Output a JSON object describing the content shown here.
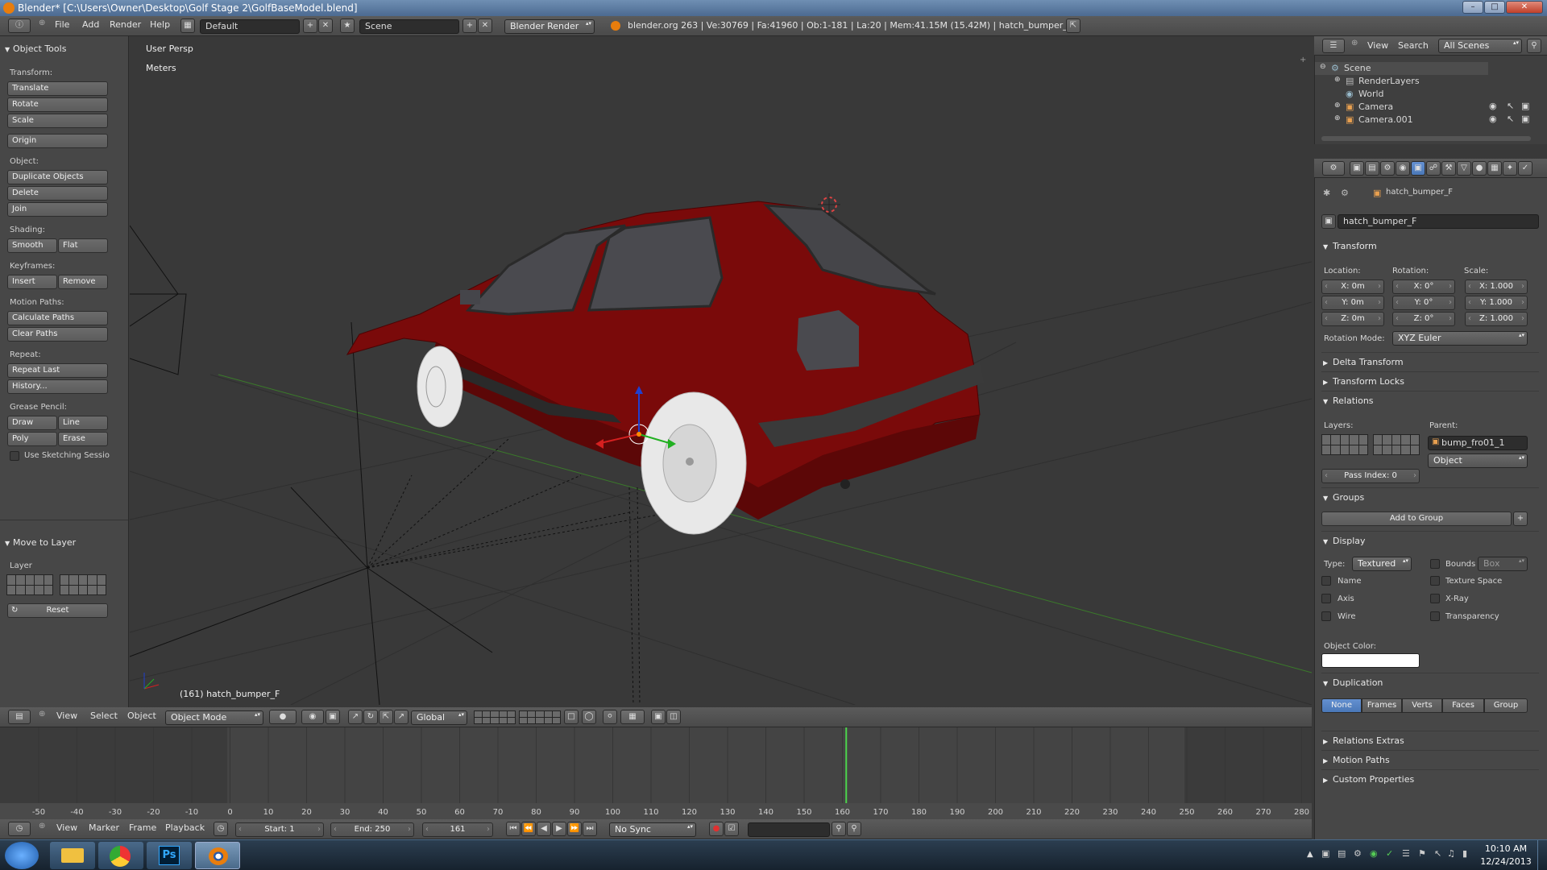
{
  "window": {
    "title": "Blender* [C:\\Users\\Owner\\Desktop\\Golf Stage 2\\GolfBaseModel.blend]",
    "controls": [
      "–",
      "□",
      "✕"
    ]
  },
  "info_header": {
    "menus": [
      "File",
      "Add",
      "Render",
      "Help"
    ],
    "screen_layout": "Default",
    "scene": "Scene",
    "render_engine": "Blender Render",
    "stats": "blender.org 263 | Ve:30769 | Fa:41960 | Ob:1-181 | La:20 | Mem:41.15M (15.42M) | hatch_bumper_F"
  },
  "tool_shelf": {
    "title": "Object Tools",
    "transform_label": "Transform:",
    "translate": "Translate",
    "rotate": "Rotate",
    "scale": "Scale",
    "origin": "Origin",
    "object_label": "Object:",
    "duplicate": "Duplicate Objects",
    "delete": "Delete",
    "join": "Join",
    "shading_label": "Shading:",
    "smooth": "Smooth",
    "flat": "Flat",
    "keyframes_label": "Keyframes:",
    "insert": "Insert",
    "remove": "Remove",
    "motion_label": "Motion Paths:",
    "calc_paths": "Calculate Paths",
    "clear_paths": "Clear Paths",
    "repeat_label": "Repeat:",
    "repeat_last": "Repeat Last",
    "history": "History...",
    "grease_label": "Grease Pencil:",
    "draw": "Draw",
    "line": "Line",
    "poly": "Poly",
    "erase": "Erase",
    "sketching": "Use Sketching Sessio",
    "move_layer_title": "Move to Layer",
    "layer_label": "Layer",
    "reset": "Reset"
  },
  "viewport": {
    "view_name": "User Persp",
    "units": "Meters",
    "object_info": "(161) hatch_bumper_F",
    "car_color": "#7a0a0a",
    "wheel_color": "#e8e8e8"
  },
  "view3d_header": {
    "menus": [
      "View",
      "Select",
      "Object"
    ],
    "mode": "Object Mode",
    "orientation": "Global"
  },
  "outliner": {
    "menus": [
      "View",
      "Search"
    ],
    "filter": "All Scenes",
    "items": [
      {
        "label": "Scene"
      },
      {
        "label": "RenderLayers"
      },
      {
        "label": "World"
      },
      {
        "label": "Camera"
      },
      {
        "label": "Camera.001"
      }
    ]
  },
  "properties": {
    "breadcrumb": "hatch_bumper_F",
    "object_name": "hatch_bumper_F",
    "transform": {
      "title": "Transform",
      "location_label": "Location:",
      "rotation_label": "Rotation:",
      "scale_label": "Scale:",
      "location": [
        "X: 0m",
        "Y: 0m",
        "Z: 0m"
      ],
      "rotation": [
        "X: 0°",
        "Y: 0°",
        "Z: 0°"
      ],
      "scale": [
        "X: 1.000",
        "Y: 1.000",
        "Z: 1.000"
      ],
      "rotation_mode_label": "Rotation Mode:",
      "rotation_mode": "XYZ Euler"
    },
    "delta_transform": "Delta Transform",
    "transform_locks": "Transform Locks",
    "relations": {
      "title": "Relations",
      "layers_label": "Layers:",
      "parent_label": "Parent:",
      "parent": "bump_fro01_1",
      "parent_type": "Object",
      "pass_index": "Pass Index: 0"
    },
    "groups": {
      "title": "Groups",
      "add_to_group": "Add to Group"
    },
    "display": {
      "title": "Display",
      "type_label": "Type:",
      "type": "Textured",
      "bounds": "Bounds",
      "bounds_type": "Box",
      "name": "Name",
      "texture_space": "Texture Space",
      "axis": "Axis",
      "xray": "X-Ray",
      "wire": "Wire",
      "transparency": "Transparency",
      "object_color_label": "Object Color:"
    },
    "duplication": {
      "title": "Duplication",
      "tabs": [
        "None",
        "Frames",
        "Verts",
        "Faces",
        "Group"
      ]
    },
    "relations_extras": "Relations Extras",
    "motion_paths": "Motion Paths",
    "custom_properties": "Custom Properties"
  },
  "timeline": {
    "ruler": [
      "-50",
      "-40",
      "-30",
      "-20",
      "-10",
      "0",
      "10",
      "20",
      "30",
      "40",
      "50",
      "60",
      "70",
      "80",
      "90",
      "100",
      "110",
      "120",
      "130",
      "140",
      "150",
      "160",
      "170",
      "180",
      "190",
      "200",
      "210",
      "220",
      "230",
      "240",
      "250",
      "260",
      "270",
      "280"
    ],
    "current_frame_value": 161,
    "menus": [
      "View",
      "Marker",
      "Frame",
      "Playback"
    ],
    "start": "Start: 1",
    "end": "End: 250",
    "current_frame": "161",
    "sync": "No Sync"
  },
  "taskbar": {
    "apps": [
      "explorer-icon",
      "chrome-icon",
      "photoshop-icon",
      "blender-icon"
    ],
    "ps_label": "Ps",
    "time": "10:10 AM",
    "date": "12/24/2013"
  }
}
